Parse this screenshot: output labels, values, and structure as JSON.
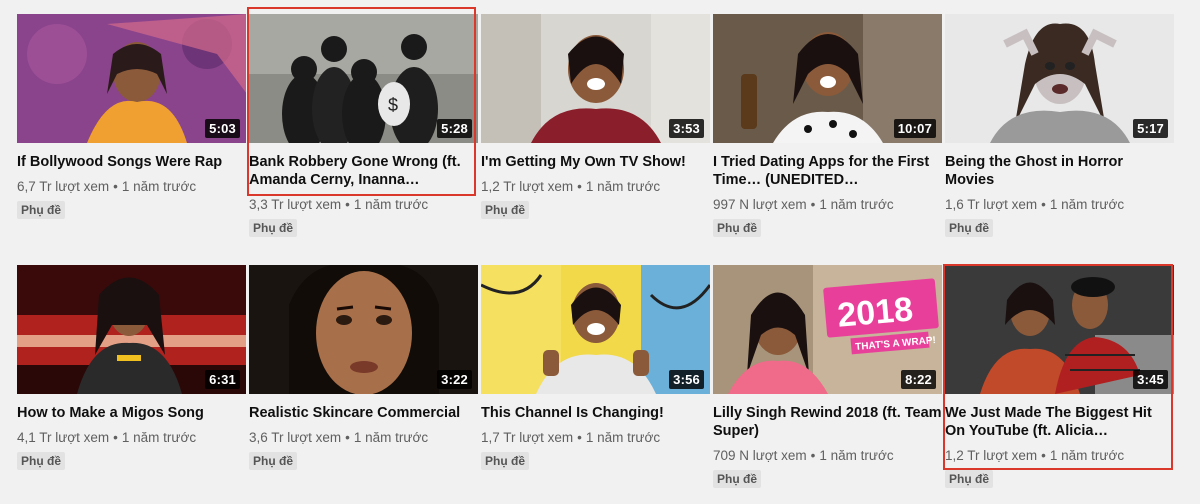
{
  "videos": [
    {
      "title": "If Bollywood Songs Were Rap",
      "views": "6,7 Tr lượt xem",
      "age": "1 năm trước",
      "badge": "Phụ đề",
      "duration": "5:03",
      "thumb_color": "#7a3f8f",
      "accent_color": "#f0a030"
    },
    {
      "title": "Bank Robbery Gone Wrong (ft. Amanda Cerny, Inanna…",
      "views": "3,3 Tr lượt xem",
      "age": "1 năm trước",
      "badge": "Phụ đề",
      "duration": "5:28",
      "thumb_color": "#8c8c86",
      "accent_color": "#1a1a1a"
    },
    {
      "title": "I'm Getting My Own TV Show!",
      "views": "1,2 Tr lượt xem",
      "age": "1 năm trước",
      "badge": "Phụ đề",
      "duration": "3:53",
      "thumb_color": "#d8d6d0",
      "accent_color": "#8a1f2b"
    },
    {
      "title": "I Tried Dating Apps for the First Time… (UNEDITED…",
      "views": "997 N lượt xem",
      "age": "1 năm trước",
      "badge": "Phụ đề",
      "duration": "10:07",
      "thumb_color": "#6a5a4a",
      "accent_color": "#f4f4f4"
    },
    {
      "title": "Being the Ghost in Horror Movies",
      "views": "1,6 Tr lượt xem",
      "age": "1 năm trước",
      "badge": "Phụ đề",
      "duration": "5:17",
      "thumb_color": "#e8e8e8",
      "accent_color": "#9a9a9a"
    },
    {
      "title": "How to Make a Migos Song",
      "views": "4,1 Tr lượt xem",
      "age": "1 năm trước",
      "badge": "Phụ đề",
      "duration": "6:31",
      "thumb_color": "#b0221e",
      "accent_color": "#2a2a2a"
    },
    {
      "title": "Realistic Skincare Commercial",
      "views": "3,6 Tr lượt xem",
      "age": "1 năm trước",
      "badge": "Phụ đề",
      "duration": "3:22",
      "thumb_color": "#1a1410",
      "accent_color": "#a8704a"
    },
    {
      "title": "This Channel Is Changing!",
      "views": "1,7 Tr lượt xem",
      "age": "1 năm trước",
      "badge": "Phụ đề",
      "duration": "3:56",
      "thumb_color": "#f2d94a",
      "accent_color": "#e8e8e8"
    },
    {
      "title": "Lilly Singh Rewind 2018 (ft. Team Super)",
      "views": "709 N lượt xem",
      "age": "1 năm trước",
      "badge": "Phụ đề",
      "duration": "8:22",
      "thumb_color": "#c8b49a",
      "accent_color": "#e8409a",
      "overlay_big": "2018",
      "overlay_small": "THAT'S A WRAP!"
    },
    {
      "title": "We Just Made The Biggest Hit On YouTube (ft. Alicia…",
      "views": "1,2 Tr lượt xem",
      "age": "1 năm trước",
      "badge": "Phụ đề",
      "duration": "3:45",
      "thumb_color": "#3a3a3a",
      "accent_color": "#b02020"
    }
  ],
  "dot": "•",
  "highlight_color": "#d9382a"
}
